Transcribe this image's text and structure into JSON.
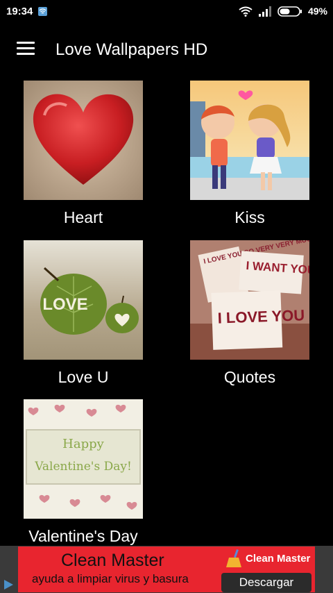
{
  "status": {
    "time": "19:34",
    "battery": "49%"
  },
  "appbar": {
    "title": "Love Wallpapers HD"
  },
  "categories": [
    {
      "label": "Heart"
    },
    {
      "label": "Kiss"
    },
    {
      "label": "Love U",
      "image_text": "LOVE"
    },
    {
      "label": "Quotes",
      "image_text": [
        "I LOVE YOU SO VERY VERY MUCH",
        "I WANT YOU",
        "I LOVE YOU"
      ]
    },
    {
      "label": "Valentine's Day",
      "image_text": [
        "Happy",
        "Valentine's Day!"
      ]
    }
  ],
  "ad": {
    "title": "Clean Master",
    "subtitle": "ayuda a limpiar virus y basura",
    "brand": "Clean Master",
    "button": "Descargar"
  }
}
